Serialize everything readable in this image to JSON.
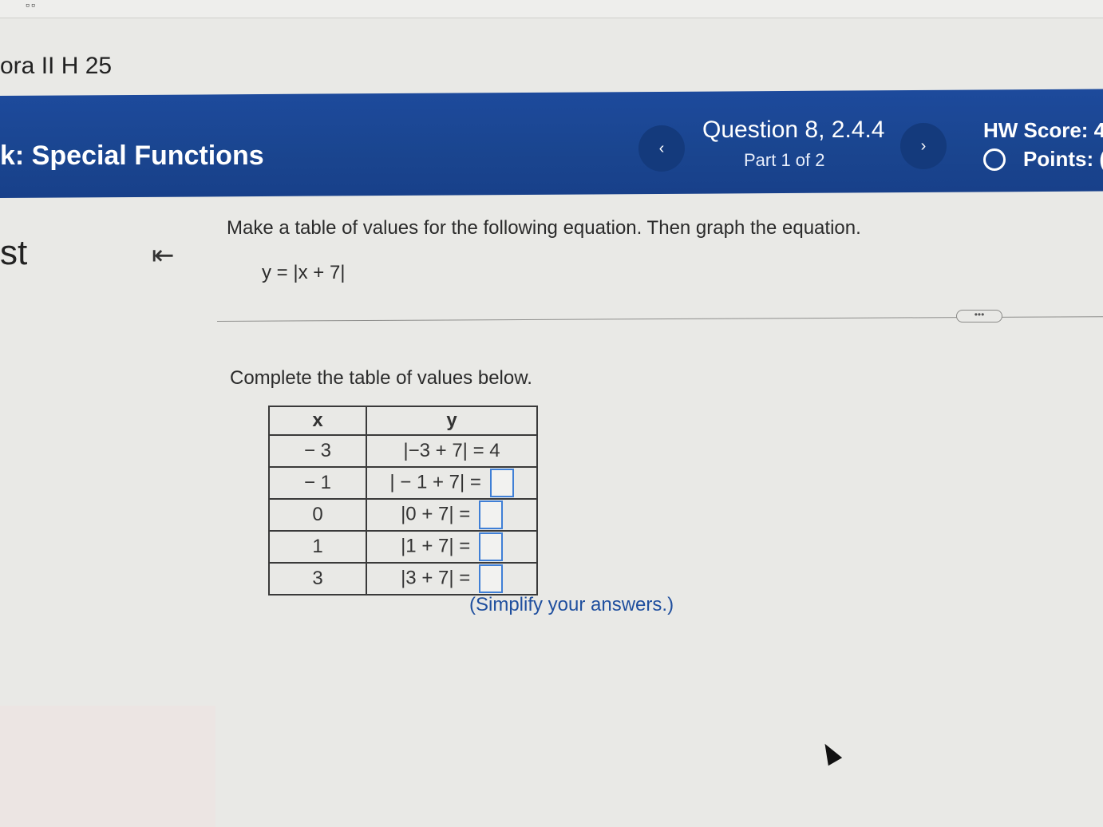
{
  "top_icon": "▫▫",
  "course": {
    "title": "ora II H 25"
  },
  "header": {
    "section_title": "k: Special Functions",
    "question_title": "Question 8, 2.4.4",
    "question_part": "Part 1 of 2",
    "prev_label": "‹",
    "next_label": "›",
    "hw_score": "HW Score: 4",
    "points": "Points: ("
  },
  "sidebar": {
    "letter": "st",
    "collapse_icon": "⇤"
  },
  "problem": {
    "prompt": "Make a table of values for the following equation. Then graph the equation.",
    "equation": "y = |x + 7|",
    "more_label": "•••",
    "instruction": "Complete the table of values below.",
    "hint": "(Simplify your answers.)"
  },
  "table": {
    "headers": [
      "x",
      "y"
    ],
    "rows": [
      {
        "x": "− 3",
        "expr": "|−3 + 7|",
        "answer": "= 4"
      },
      {
        "x": "− 1",
        "expr": "| − 1 + 7|",
        "answer": "="
      },
      {
        "x": "0",
        "expr": "|0 + 7|",
        "answer": "="
      },
      {
        "x": "1",
        "expr": "|1 + 7|",
        "answer": "="
      },
      {
        "x": "3",
        "expr": "|3 + 7|",
        "answer": "="
      }
    ]
  }
}
